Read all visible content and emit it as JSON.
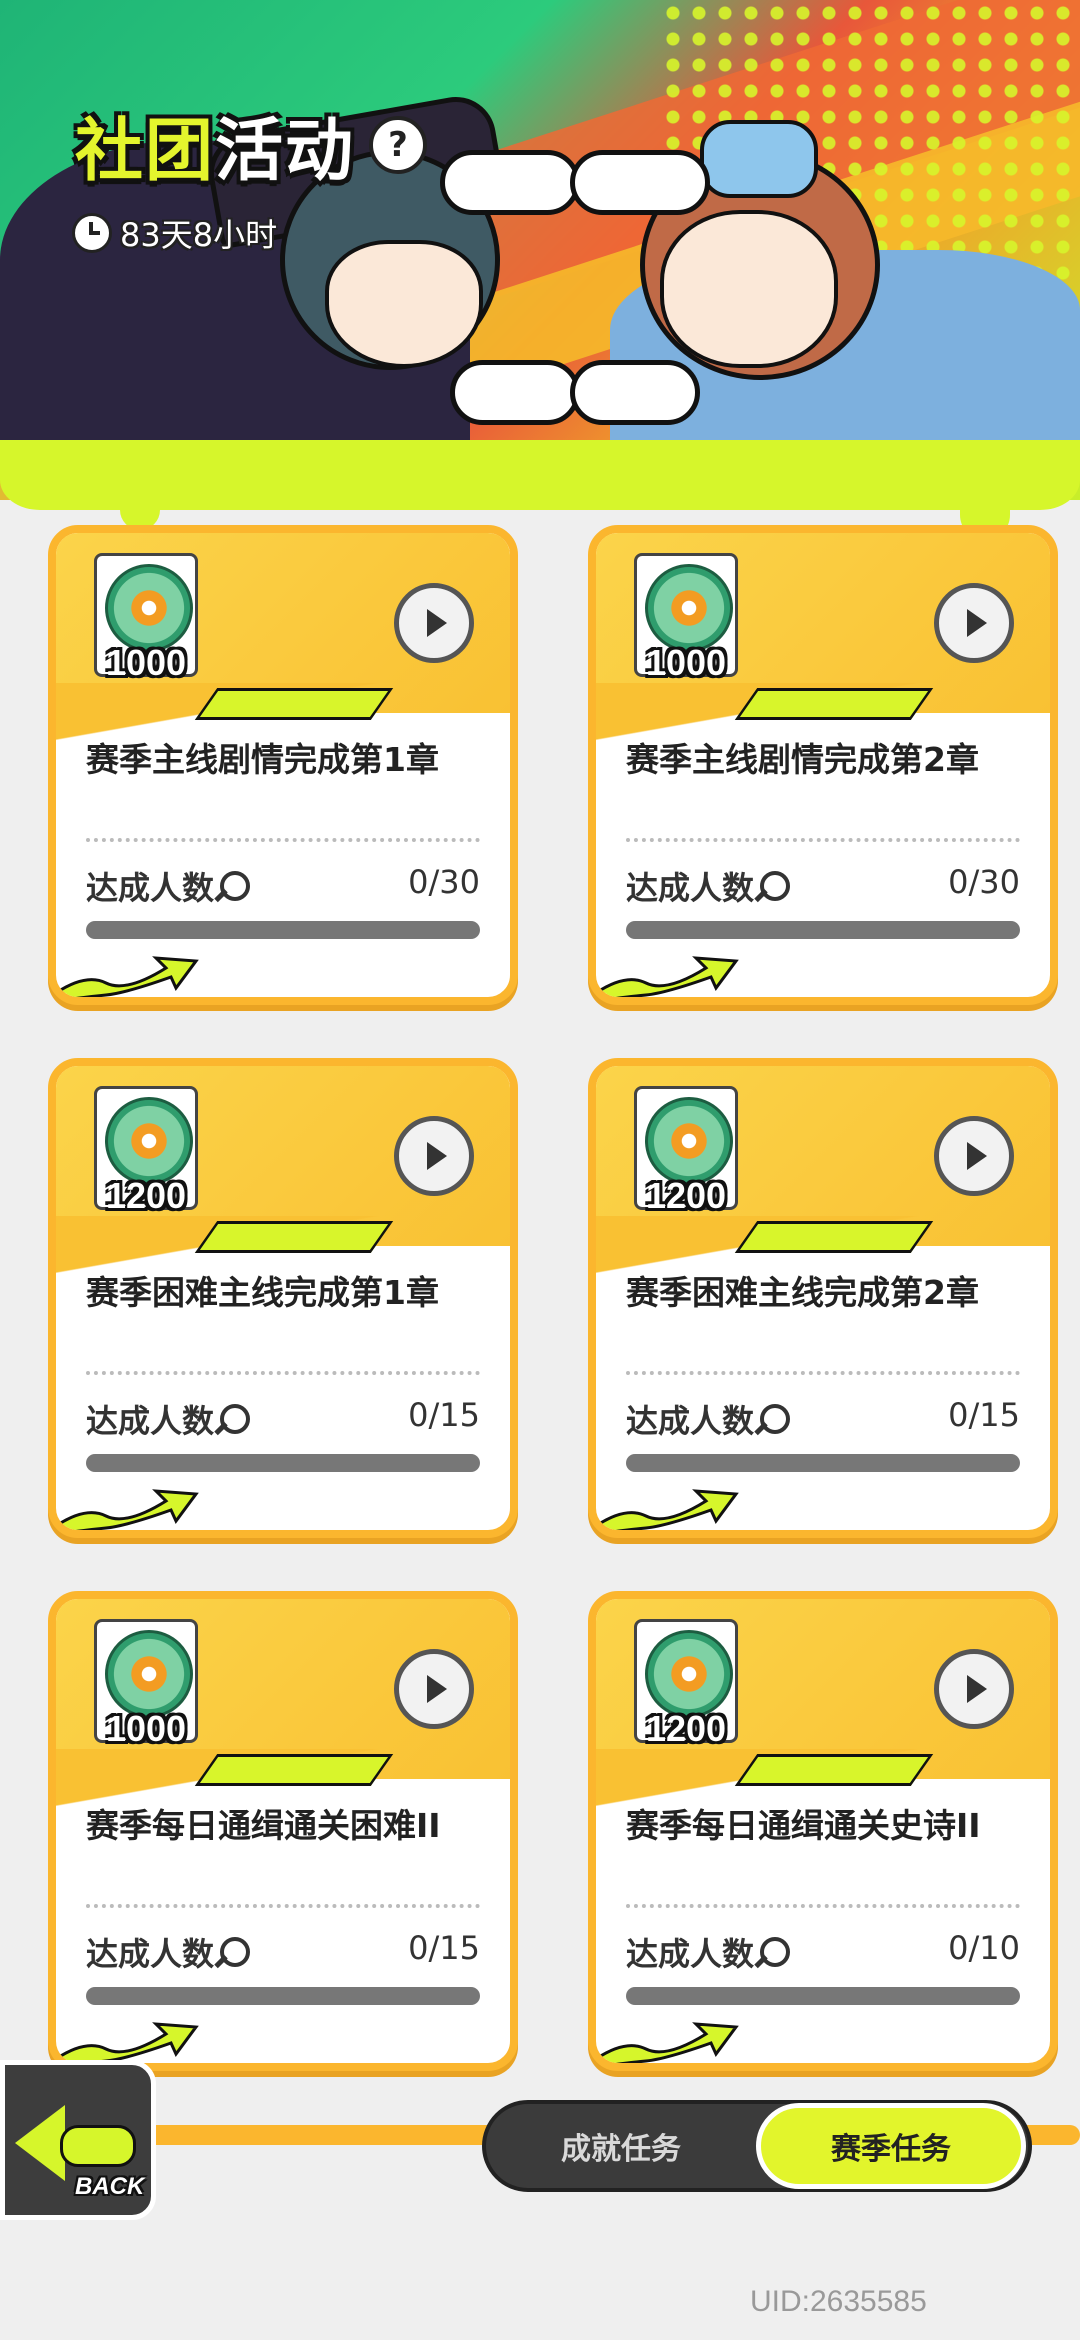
{
  "header": {
    "title_part1": "社团",
    "title_part2": "活动",
    "help_icon": "?",
    "timer": "83天8小时"
  },
  "cards": [
    {
      "amount": "1000",
      "name": "赛季主线剧情完成第1章",
      "count_label": "达成人数",
      "count": "0/30",
      "progress": 0
    },
    {
      "amount": "1000",
      "name": "赛季主线剧情完成第2章",
      "count_label": "达成人数",
      "count": "0/30",
      "progress": 0
    },
    {
      "amount": "1200",
      "name": "赛季困难主线完成第1章",
      "count_label": "达成人数",
      "count": "0/15",
      "progress": 0
    },
    {
      "amount": "1200",
      "name": "赛季困难主线完成第2章",
      "count_label": "达成人数",
      "count": "0/15",
      "progress": 0
    },
    {
      "amount": "1000",
      "name": "赛季每日通缉通关困难II",
      "count_label": "达成人数",
      "count": "0/15",
      "progress": 0
    },
    {
      "amount": "1200",
      "name": "赛季每日通缉通关史诗II",
      "count_label": "达成人数",
      "count": "0/10",
      "progress": 0
    }
  ],
  "back": {
    "label": "BACK"
  },
  "tabs": {
    "achievement": "成就任务",
    "season": "赛季任务"
  },
  "uid": "UID:2635585",
  "colors": {
    "accent": "#e2f52c",
    "card_border": "#fbb62e",
    "bar": "#777777"
  }
}
